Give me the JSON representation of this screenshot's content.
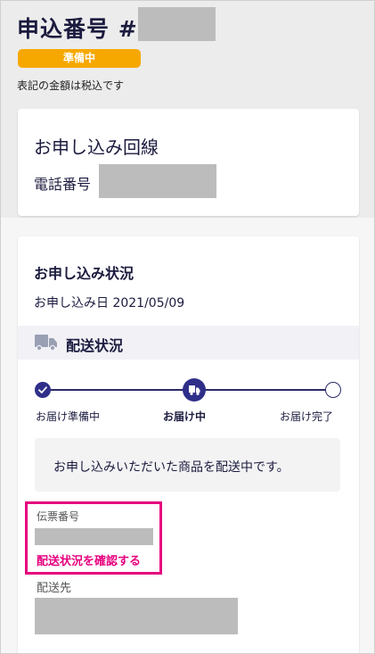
{
  "header": {
    "title": "申込番号 #",
    "status_badge": "準備中",
    "tax_note": "表記の金額は税込です"
  },
  "line_card": {
    "title": "お申し込み回線",
    "phone_label": "電話番号"
  },
  "status_card": {
    "title": "お申し込み状況",
    "order_date": "お申し込み日 2021/05/09",
    "shipping_title": "配送状況",
    "steps": [
      {
        "label": "お届け準備中",
        "state": "done"
      },
      {
        "label": "お届け中",
        "state": "current"
      },
      {
        "label": "お届け完了",
        "state": "pending"
      }
    ],
    "message": "お申し込みいただいた商品を配送中です。",
    "slip_label": "伝票番号",
    "track_link": "配送状況を確認する",
    "destination_label": "配送先"
  },
  "colors": {
    "badge": "#f6a800",
    "accent_navy": "#2f2f8a",
    "highlight": "#e6007e"
  }
}
